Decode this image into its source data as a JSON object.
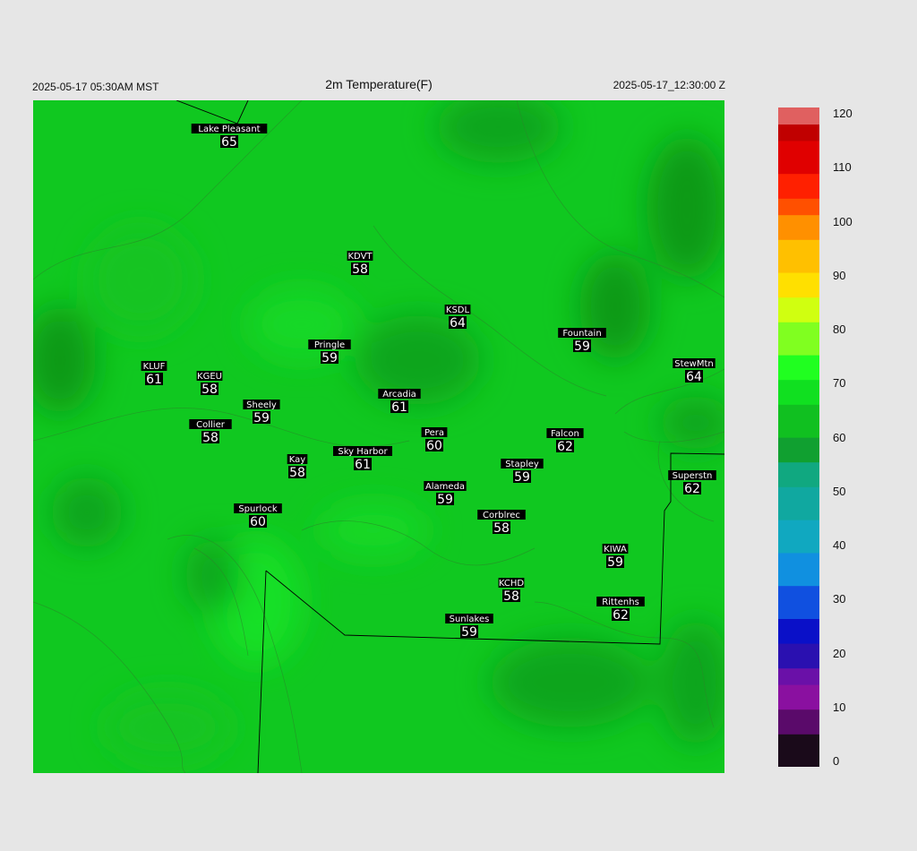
{
  "header": {
    "local_time": "2025-05-17 05:30AM MST",
    "title": "2m Temperature(F)",
    "utc_time": "2025-05-17_12:30:00 Z"
  },
  "colorbar": {
    "min": 0,
    "max": 120,
    "ticks": [
      "120",
      "110",
      "100",
      "90",
      "80",
      "70",
      "60",
      "50",
      "40",
      "30",
      "20",
      "10",
      "0"
    ],
    "stops": [
      {
        "v": 0,
        "c": "#1a0a1a"
      },
      {
        "v": 5,
        "c": "#5a0a6a"
      },
      {
        "v": 10,
        "c": "#8a10a0"
      },
      {
        "v": 15,
        "c": "#6a10a8"
      },
      {
        "v": 18,
        "c": "#2a10b0"
      },
      {
        "v": 22,
        "c": "#0a10c8"
      },
      {
        "v": 27,
        "c": "#1050e0"
      },
      {
        "v": 33,
        "c": "#1090e0"
      },
      {
        "v": 38,
        "c": "#10a8c0"
      },
      {
        "v": 45,
        "c": "#10a8a0"
      },
      {
        "v": 50,
        "c": "#10a880"
      },
      {
        "v": 55,
        "c": "#10a030"
      },
      {
        "v": 60,
        "c": "#10c020"
      },
      {
        "v": 66,
        "c": "#10e020"
      },
      {
        "v": 70,
        "c": "#20ff20"
      },
      {
        "v": 75,
        "c": "#80ff20"
      },
      {
        "v": 80,
        "c": "#d0ff10"
      },
      {
        "v": 85,
        "c": "#ffe000"
      },
      {
        "v": 90,
        "c": "#ffc000"
      },
      {
        "v": 95,
        "c": "#ff9000"
      },
      {
        "v": 100,
        "c": "#ff5000"
      },
      {
        "v": 103,
        "c": "#ff2000"
      },
      {
        "v": 108,
        "c": "#e00000"
      },
      {
        "v": 113,
        "c": "#c00000"
      },
      {
        "v": 116,
        "c": "#e06060"
      },
      {
        "v": 120,
        "c": "#d0d0d0"
      }
    ]
  },
  "map": {
    "base_color": "#10c820",
    "stations": [
      {
        "name": "Lake Pleasant",
        "value": "65"
      },
      {
        "name": "KDVT",
        "value": "58"
      },
      {
        "name": "KSDL",
        "value": "64"
      },
      {
        "name": "Fountain",
        "value": "59"
      },
      {
        "name": "Pringle",
        "value": "59"
      },
      {
        "name": "KLUF",
        "value": "61"
      },
      {
        "name": "KGEU",
        "value": "58"
      },
      {
        "name": "StewMtn",
        "value": "64"
      },
      {
        "name": "Arcadia",
        "value": "61"
      },
      {
        "name": "Sheely",
        "value": "59"
      },
      {
        "name": "Collier",
        "value": "58"
      },
      {
        "name": "Pera",
        "value": "60"
      },
      {
        "name": "Falcon",
        "value": "62"
      },
      {
        "name": "Sky Harbor",
        "value": "61"
      },
      {
        "name": "Kay",
        "value": "58"
      },
      {
        "name": "Stapley",
        "value": "59"
      },
      {
        "name": "Superstn",
        "value": "62"
      },
      {
        "name": "Alameda",
        "value": "59"
      },
      {
        "name": "Spurlock",
        "value": "60"
      },
      {
        "name": "Corblrec",
        "value": "58"
      },
      {
        "name": "KIWA",
        "value": "59"
      },
      {
        "name": "KCHD",
        "value": "58"
      },
      {
        "name": "Rittenhs",
        "value": "62"
      },
      {
        "name": "Sunlakes",
        "value": "59"
      }
    ]
  }
}
